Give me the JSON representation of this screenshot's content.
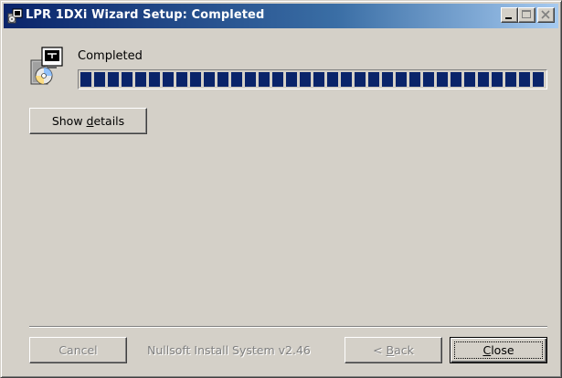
{
  "window": {
    "title": "LPR 1DXi Wizard Setup: Completed",
    "title_icon": "installer-icon",
    "controls": [
      "minimize-icon",
      "maximize-icon",
      "close-icon"
    ]
  },
  "header": {
    "icon": "setup-package-icon",
    "status_text": "Completed",
    "progress_fraction": 1.0
  },
  "details_button": {
    "pre": "Show ",
    "accel": "d",
    "post": "etails"
  },
  "footer": {
    "cancel_label": "Cancel",
    "branding": "Nullsoft Install System v2.46",
    "back": {
      "pre": "< ",
      "accel": "B",
      "post": "ack"
    },
    "close": {
      "pre": "",
      "accel": "C",
      "post": "lose"
    }
  },
  "colors": {
    "titlebar_start": "#0a246a",
    "titlebar_end": "#a6caf0",
    "progress_fill": "#0a246a",
    "dialog_face": "#d4d0c8",
    "disabled_text": "#808080"
  }
}
